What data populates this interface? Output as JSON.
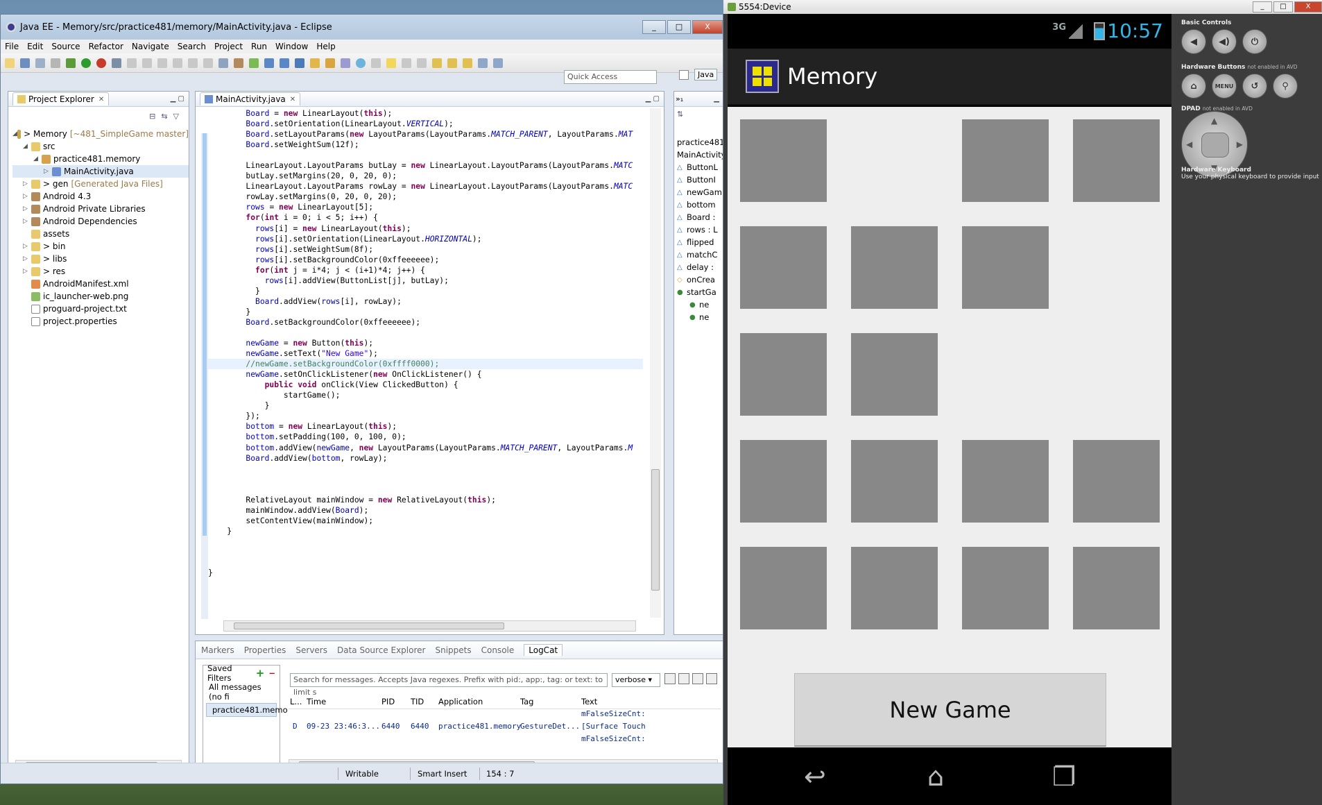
{
  "eclipse": {
    "title": "Java EE - Memory/src/practice481/memory/MainActivity.java - Eclipse",
    "min": "_",
    "max": "□",
    "close": "X",
    "menu": [
      "File",
      "Edit",
      "Source",
      "Refactor",
      "Navigate",
      "Search",
      "Project",
      "Run",
      "Window",
      "Help"
    ],
    "quick_access": "Quick Access",
    "perspective": "Java",
    "project_explorer": {
      "tab": "Project Explorer",
      "items": [
        {
          "label": "> Memory",
          "extra": "[~481_SimpleGame master]",
          "depth": 0,
          "tw": "◢",
          "icon": "proj"
        },
        {
          "label": "src",
          "extra": "",
          "depth": 1,
          "tw": "◢",
          "icon": "fold"
        },
        {
          "label": "practice481.memory",
          "extra": "",
          "depth": 2,
          "tw": "◢",
          "icon": "pkg"
        },
        {
          "label": "MainActivity.java",
          "extra": "",
          "depth": 3,
          "tw": "▷",
          "icon": "java"
        },
        {
          "label": "> gen",
          "extra": "[Generated Java Files]",
          "depth": 1,
          "tw": "▷",
          "icon": "fold"
        },
        {
          "label": "Android 4.3",
          "extra": "",
          "depth": 1,
          "tw": "▷",
          "icon": "lib"
        },
        {
          "label": "Android Private Libraries",
          "extra": "",
          "depth": 1,
          "tw": "▷",
          "icon": "lib"
        },
        {
          "label": "Android Dependencies",
          "extra": "",
          "depth": 1,
          "tw": "▷",
          "icon": "lib"
        },
        {
          "label": "assets",
          "extra": "",
          "depth": 1,
          "tw": "",
          "icon": "fold"
        },
        {
          "label": "> bin",
          "extra": "",
          "depth": 1,
          "tw": "▷",
          "icon": "fold"
        },
        {
          "label": "> libs",
          "extra": "",
          "depth": 1,
          "tw": "▷",
          "icon": "fold"
        },
        {
          "label": "> res",
          "extra": "",
          "depth": 1,
          "tw": "▷",
          "icon": "fold"
        },
        {
          "label": "AndroidManifest.xml",
          "extra": "",
          "depth": 1,
          "tw": "",
          "icon": "xml"
        },
        {
          "label": "ic_launcher-web.png",
          "extra": "",
          "depth": 1,
          "tw": "",
          "icon": "img"
        },
        {
          "label": "proguard-project.txt",
          "extra": "",
          "depth": 1,
          "tw": "",
          "icon": "file"
        },
        {
          "label": "project.properties",
          "extra": "",
          "depth": 1,
          "tw": "",
          "icon": "file"
        }
      ]
    },
    "editor": {
      "tab": "MainActivity.java",
      "lines": [
        "        Board = new LinearLayout(this);",
        "        Board.setOrientation(LinearLayout.VERTICAL);",
        "        Board.setLayoutParams(new LayoutParams(LayoutParams.MATCH_PARENT, LayoutParams.MAT",
        "        Board.setWeightSum(12f);",
        "",
        "        LinearLayout.LayoutParams butLay = new LinearLayout.LayoutParams(LayoutParams.MATC",
        "        butLay.setMargins(20, 0, 20, 0);",
        "        LinearLayout.LayoutParams rowLay = new LinearLayout.LayoutParams(LayoutParams.MATC",
        "        rowLay.setMargins(0, 20, 0, 20);",
        "        rows = new LinearLayout[5];",
        "        for(int i = 0; i < 5; i++) {",
        "          rows[i] = new LinearLayout(this);",
        "          rows[i].setOrientation(LinearLayout.HORIZONTAL);",
        "          rows[i].setWeightSum(8f);",
        "          rows[i].setBackgroundColor(0xffeeeeee);",
        "          for(int j = i*4; j < (i+1)*4; j++) {",
        "            rows[i].addView(ButtonList[j], butLay);",
        "          }",
        "          Board.addView(rows[i], rowLay);",
        "        }",
        "        Board.setBackgroundColor(0xffeeeeee);",
        "",
        "        newGame = new Button(this);",
        "        newGame.setText(\"New Game\");",
        "        //newGame.setBackgroundColor(0xffff0000);",
        "        newGame.setOnClickListener(new OnClickListener() {",
        "            public void onClick(View ClickedButton) {",
        "                startGame();",
        "            }",
        "        });",
        "        bottom = new LinearLayout(this);",
        "        bottom.setPadding(100, 0, 100, 0);",
        "        bottom.addView(newGame, new LayoutParams(LayoutParams.MATCH_PARENT, LayoutParams.M",
        "        Board.addView(bottom, rowLay);",
        "",
        "",
        "",
        "        RelativeLayout mainWindow = new RelativeLayout(this);",
        "        mainWindow.addView(Board);",
        "        setContentView(mainWindow);",
        "    }",
        "",
        "",
        "",
        "}"
      ]
    },
    "outline": {
      "header": "practice481.",
      "header2": "MainActivity",
      "items": [
        "ButtonL",
        "ButtonI",
        "newGam",
        "bottom",
        "Board :",
        "rows : L",
        "flipped",
        "matchC",
        "delay :",
        "onCrea",
        "startGa",
        "ne",
        "ne"
      ]
    },
    "console": {
      "tabs": [
        "Markers",
        "Properties",
        "Servers",
        "Data Source Explorer",
        "Snippets",
        "Console",
        "LogCat"
      ],
      "saved_filters": "Saved Filters",
      "filters": [
        "All messages (no fi",
        "practice481.memo"
      ],
      "search_placeholder": "Search for messages. Accepts Java regexes. Prefix with pid:, app:, tag: or text: to limit s",
      "level": "verbose",
      "columns": [
        "L...",
        "Time",
        "PID",
        "TID",
        "Application",
        "Tag",
        "Text"
      ],
      "rows": [
        {
          "level": "",
          "time": "",
          "pid": "",
          "tid": "",
          "app": "",
          "tag": "",
          "text": "mFalseSizeCnt:"
        },
        {
          "level": "D",
          "time": "09-23 23:46:3...",
          "pid": "6440",
          "tid": "6440",
          "app": "practice481.memory",
          "tag": "GestureDet...",
          "text": "[Surface Touch"
        },
        {
          "level": "",
          "time": "",
          "pid": "",
          "tid": "",
          "app": "",
          "tag": "",
          "text": "mFalseSizeCnt:"
        }
      ]
    },
    "status": {
      "writable": "Writable",
      "insert": "Smart Insert",
      "position": "154 : 7"
    }
  },
  "emulator": {
    "title": "5554:Device",
    "network": "3G",
    "clock": "10:57",
    "app_title": "Memory",
    "new_game": "New Game",
    "tiles": [
      [
        1,
        0,
        1,
        1
      ],
      [
        1,
        1,
        1,
        0
      ],
      [
        1,
        1,
        0,
        0
      ],
      [
        1,
        1,
        1,
        1
      ],
      [
        1,
        1,
        1,
        1
      ]
    ],
    "controls": {
      "basic": "Basic Controls",
      "hw_buttons": "Hardware Buttons",
      "hw_note": "not enabled in AVD",
      "menu": "MENU",
      "dpad": "DPAD",
      "dpad_note": "not enabled in AVD",
      "kb": "Hardware Keyboard",
      "kb_note": "Use your physical keyboard to provide input"
    }
  }
}
